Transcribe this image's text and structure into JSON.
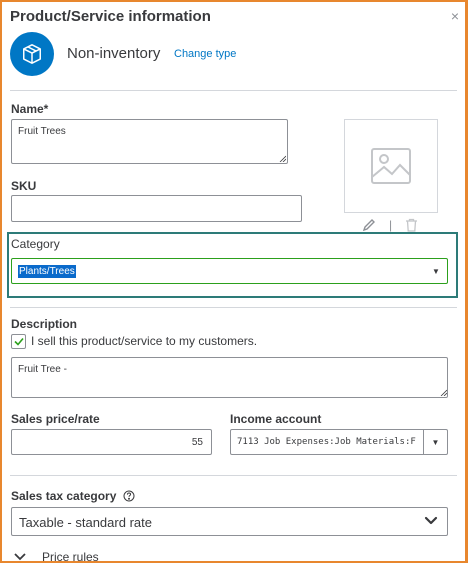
{
  "panel": {
    "title": "Product/Service information",
    "close_glyph": "×"
  },
  "type": {
    "icon": "box-icon",
    "name": "Non-inventory",
    "change_label": "Change type"
  },
  "name": {
    "label": "Name*",
    "value": "Fruit Trees"
  },
  "sku": {
    "label": "SKU",
    "value": ""
  },
  "image": {
    "icon": "image-placeholder-icon",
    "edit_icon": "pencil-icon",
    "separator": "|",
    "delete_icon": "trash-icon"
  },
  "category": {
    "label": "Category",
    "value": "Plants/Trees",
    "highlight_color": "#2d7b78"
  },
  "description": {
    "label": "Description",
    "checkbox_label": "I sell this product/service to my customers.",
    "checked": true,
    "value": "Fruit Tree -"
  },
  "sales_price": {
    "label": "Sales price/rate",
    "value": "55"
  },
  "income_account": {
    "label": "Income account",
    "value": "7113 Job Expenses:Job Materials:F"
  },
  "sales_tax": {
    "label": "Sales tax category",
    "help_icon": "question-circle-icon",
    "value": "Taxable - standard rate"
  },
  "price_rules": {
    "label": "Price rules",
    "icon": "chevron-down-icon"
  },
  "colors": {
    "frame": "#e8872e",
    "brand_blue": "#0077c5",
    "green_focus": "#2ca01c",
    "selection": "#0a6acb"
  }
}
